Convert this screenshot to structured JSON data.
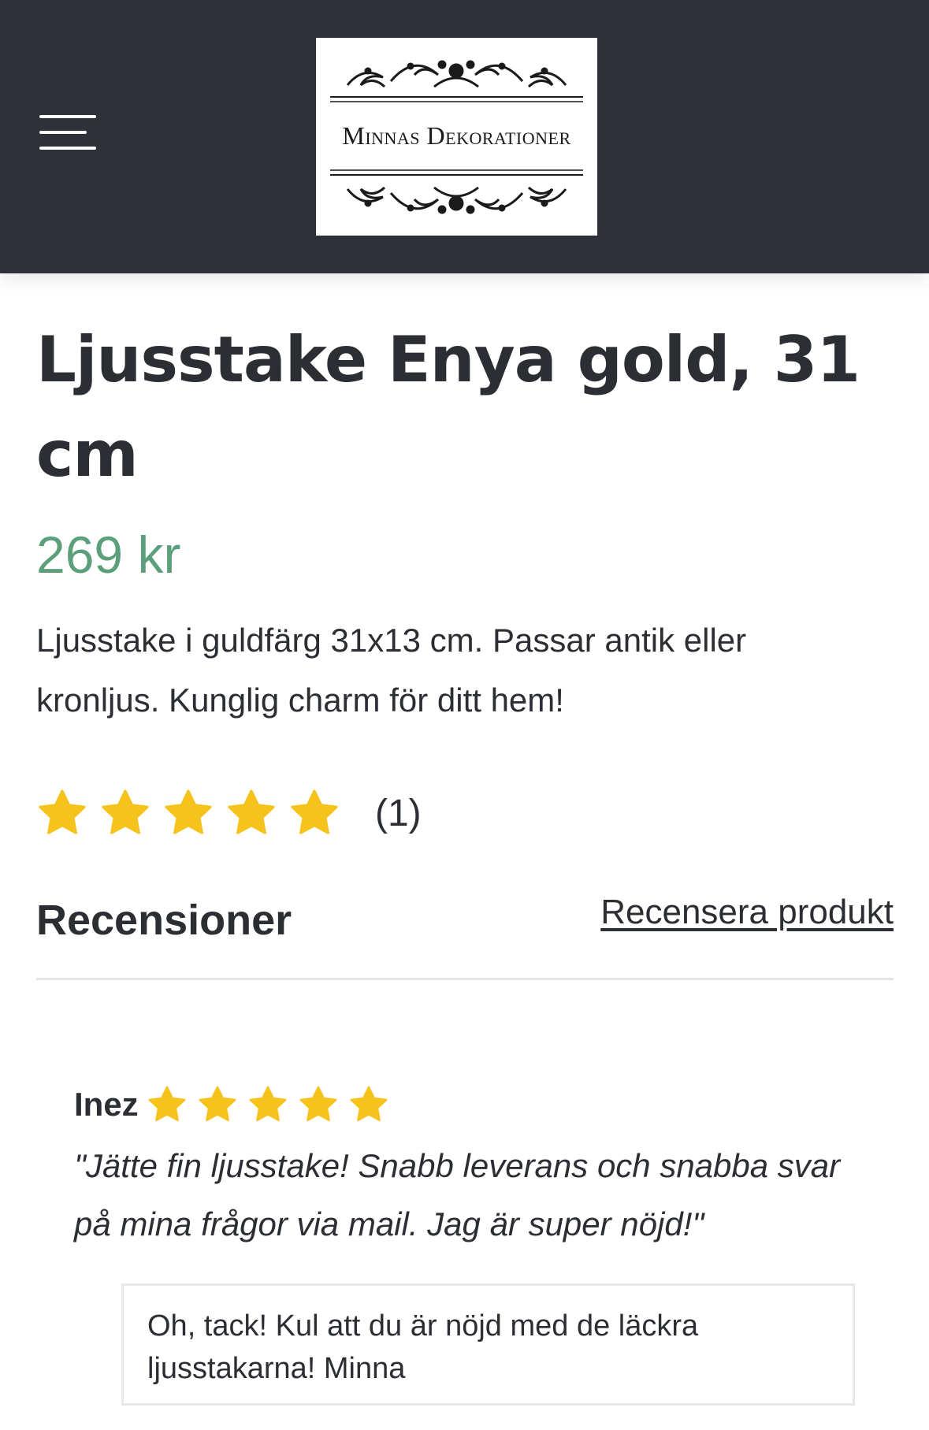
{
  "header": {
    "brand_name": "Minnas Dekorationer",
    "background_color": "#2e3138"
  },
  "product": {
    "title": "Ljusstake Enya gold, 31 cm",
    "price": "269 kr",
    "price_color": "#5b9f7b",
    "description": "Ljusstake i guldfärg 31x13 cm. Passar antik eller kronljus. Kunglig charm för ditt hem!",
    "rating": {
      "stars": 5,
      "max_stars": 5,
      "count_label": "(1)",
      "star_color": "#f6c31c"
    }
  },
  "reviews": {
    "heading": "Recensioner",
    "write_review_label": "Recensera produkt",
    "items": [
      {
        "author": "Inez",
        "stars": 5,
        "text": "\"Jätte fin ljusstake! Snabb leverans och snabba svar på mina frågor via mail. Jag är super nöjd!\"",
        "reply": "Oh, tack! Kul att du är nöjd med de läckra ljusstakarna! Minna"
      }
    ]
  }
}
